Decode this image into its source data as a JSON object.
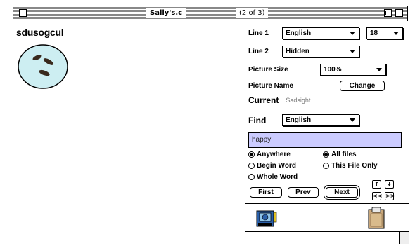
{
  "window": {
    "title": "Sally's.c",
    "page_info": "(2 of 3)"
  },
  "content": {
    "word": "sdusogcul"
  },
  "panel": {
    "line1": {
      "label": "Line 1",
      "language": "English",
      "size": "18"
    },
    "line2": {
      "label": "Line 2",
      "value": "Hidden"
    },
    "picture_size": {
      "label": "Picture Size",
      "value": "100%"
    },
    "picture_name": {
      "label": "Picture Name",
      "button": "Change"
    },
    "current": {
      "label": "Current",
      "value": "Sadsight"
    },
    "find": {
      "label": "Find",
      "language": "English",
      "query": "happy",
      "options": {
        "anywhere": "Anywhere",
        "all_files": "All files",
        "begin_word": "Begin Word",
        "this_file_only": "This File Only",
        "whole_word": "Whole Word"
      }
    },
    "buttons": {
      "first": "First",
      "prev": "Prev",
      "next": "Next"
    },
    "nav": {
      "up": "↑",
      "down": "↓",
      "first": "<<",
      "last": ">>"
    }
  },
  "colors": {
    "find_field": "#ccccff",
    "picture_fill": "#cdeef2"
  }
}
